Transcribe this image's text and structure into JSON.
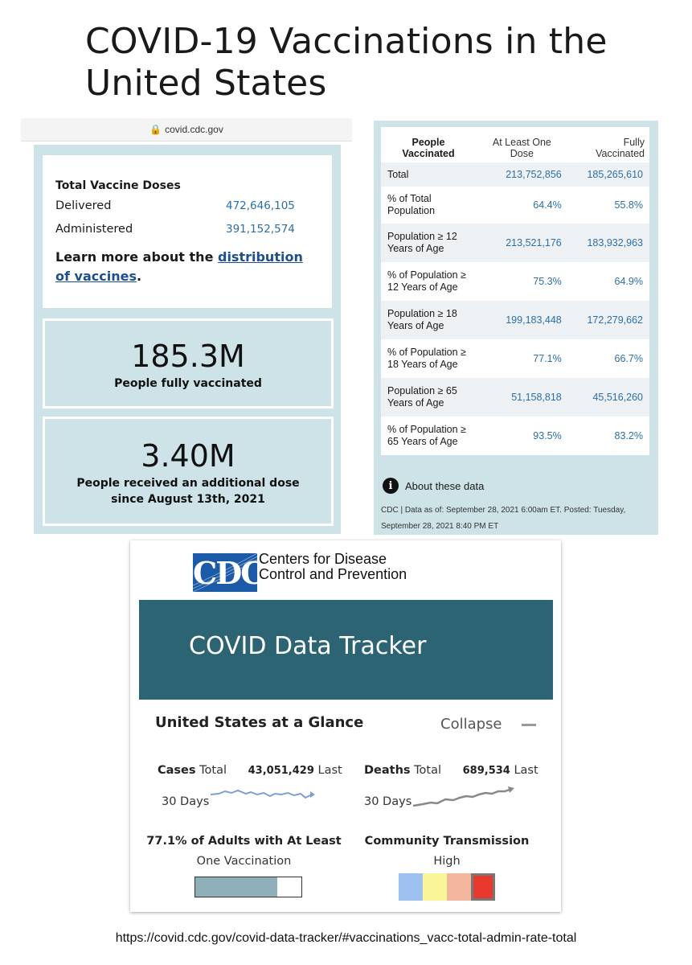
{
  "title": "COVID-19 Vaccinations in the United States",
  "browser": {
    "url": "covid.cdc.gov"
  },
  "doses": {
    "title": "Total Vaccine Doses",
    "delivered_label": "Delivered",
    "delivered_value": "472,646,105",
    "administered_label": "Administered",
    "administered_value": "391,152,574",
    "learn_prefix": "Learn more about the ",
    "learn_link": "distribution of vaccines",
    "learn_suffix": "."
  },
  "fully_vaccinated": {
    "value": "185.3M",
    "label": "People fully vaccinated"
  },
  "additional_dose": {
    "value": "3.40M",
    "label": "People received an additional dose since August 13th, 2021"
  },
  "table": {
    "headers": [
      "People Vaccinated",
      "At Least One Dose",
      "Fully Vaccinated"
    ],
    "rows": [
      [
        "Total",
        "213,752,856",
        "185,265,610"
      ],
      [
        "% of Total Population",
        "64.4%",
        "55.8%"
      ],
      [
        "Population ≥ 12 Years of Age",
        "213,521,176",
        "183,932,963"
      ],
      [
        "% of Population ≥ 12 Years of Age",
        "75.3%",
        "64.9%"
      ],
      [
        "Population ≥ 18 Years of Age",
        "199,183,448",
        "172,279,662"
      ],
      [
        "% of Population ≥ 18 Years of Age",
        "77.1%",
        "66.7%"
      ],
      [
        "Population ≥ 65 Years of Age",
        "51,158,818",
        "45,516,260"
      ],
      [
        "% of Population ≥ 65 Years of Age",
        "93.5%",
        "83.2%"
      ]
    ],
    "about": "About these data",
    "footnote": "CDC | Data as of: September 28, 2021 6:00am ET. Posted: Tuesday, September 28, 2021 8:40 PM ET"
  },
  "tracker": {
    "logo_text": "CDC",
    "org_line1": "Centers for Disease",
    "org_line2": "Control and Prevention",
    "banner": "COVID Data Tracker",
    "glance": "United States at a Glance",
    "collapse": "Collapse",
    "cases_label": "Cases",
    "cases_total": "Total",
    "cases_value": "43,051,429",
    "cases_period_a": "Last",
    "cases_period_b": "30 Days",
    "deaths_label": "Deaths",
    "deaths_total": "Total",
    "deaths_value": "689,534",
    "deaths_period_a": "Last",
    "deaths_period_b": "30 Days",
    "vax_label": "77.1% of Adults with At Least",
    "vax_label2": "One Vaccination",
    "vax_fraction": 0.771,
    "ct_label": "Community Transmission",
    "ct_level": "High",
    "ct_colors": [
      "#9ec1f2",
      "#fbf59a",
      "#f2b79d",
      "#e8392c"
    ],
    "colors": {
      "banner": "#2d6474",
      "link": "#2a6fa8",
      "panel": "#cde3e8"
    }
  },
  "source_url": "https://covid.cdc.gov/covid-data-tracker/#vaccinations_vacc-total-admin-rate-total"
}
